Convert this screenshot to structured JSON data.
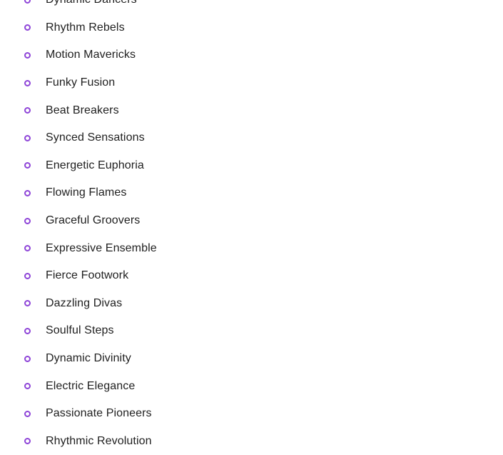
{
  "page": {
    "background_color": "#ffffff",
    "text_color": "#212121",
    "accent_color": "#8e44d8"
  },
  "list": {
    "marker_icon": "circle-outline-icon",
    "marker_color": "#8e44d8",
    "items": [
      {
        "label": "Dynamic Dancers"
      },
      {
        "label": "Rhythm Rebels"
      },
      {
        "label": "Motion Mavericks"
      },
      {
        "label": "Funky Fusion"
      },
      {
        "label": "Beat Breakers"
      },
      {
        "label": "Synced Sensations"
      },
      {
        "label": "Energetic Euphoria"
      },
      {
        "label": "Flowing Flames"
      },
      {
        "label": "Graceful Groovers"
      },
      {
        "label": "Expressive Ensemble"
      },
      {
        "label": "Fierce Footwork"
      },
      {
        "label": "Dazzling Divas"
      },
      {
        "label": "Soulful Steps"
      },
      {
        "label": "Dynamic Divinity"
      },
      {
        "label": "Electric Elegance"
      },
      {
        "label": "Passionate Pioneers"
      },
      {
        "label": "Rhythmic Revolution"
      }
    ]
  }
}
